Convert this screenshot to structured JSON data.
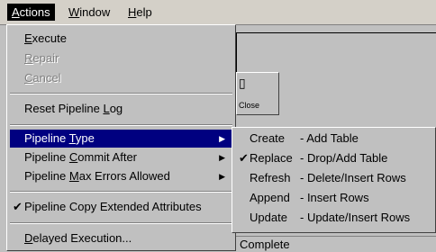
{
  "menubar": {
    "items": [
      {
        "label": "Actions",
        "mnemonic": "A",
        "rest": "ctions"
      },
      {
        "label": "Window",
        "mnemonic": "W",
        "rest": "indow"
      },
      {
        "label": "Help",
        "mnemonic": "H",
        "rest": "elp"
      }
    ]
  },
  "background": {
    "toolbar_close_label": "Close",
    "status_text": "Complete"
  },
  "actions_menu": {
    "execute": {
      "mn": "E",
      "rest": "xecute"
    },
    "repair": {
      "mn": "R",
      "rest": "epair"
    },
    "cancel": {
      "mn": "C",
      "rest": "ancel"
    },
    "reset_log": {
      "pre": "Reset Pipeline ",
      "mn": "L",
      "rest": "og"
    },
    "pipeline_type": {
      "pre": "Pipeline ",
      "mn": "T",
      "rest": "ype"
    },
    "commit_after": {
      "pre": "Pipeline ",
      "mn": "C",
      "rest": "ommit After"
    },
    "max_errors": {
      "pre": "Pipeline ",
      "mn": "M",
      "rest": "ax Errors Allowed"
    },
    "copy_ext": {
      "label": "Pipeline Copy Extended Attributes"
    },
    "delayed": {
      "mn": "D",
      "rest": "elayed Execution..."
    }
  },
  "type_submenu": {
    "items": [
      {
        "name": "Create",
        "desc": "- Add Table",
        "checked": false
      },
      {
        "name": "Replace",
        "desc": "- Drop/Add Table",
        "checked": true
      },
      {
        "name": "Refresh",
        "desc": "- Delete/Insert Rows",
        "checked": false
      },
      {
        "name": "Append",
        "desc": "- Insert Rows",
        "checked": false
      },
      {
        "name": "Update",
        "desc": "- Update/Insert Rows",
        "checked": false
      }
    ]
  },
  "glyphs": {
    "check": "✔",
    "submenu_arrow": "▶",
    "door": "▯"
  }
}
